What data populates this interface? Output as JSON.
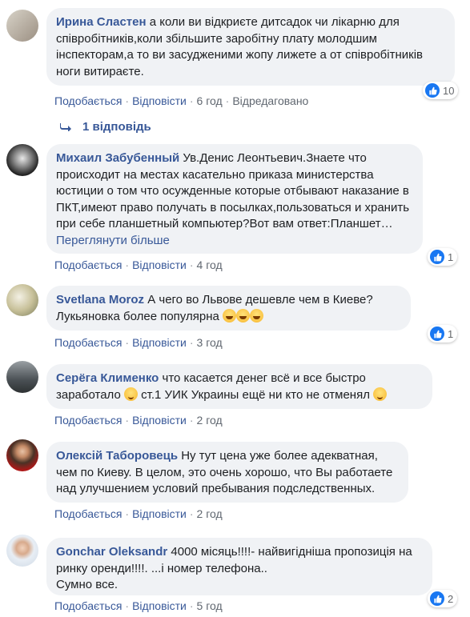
{
  "comments": [
    {
      "author": "Ирина Сластен",
      "text": "а коли ви відкриєте дитсадок чи лікарню для співробітників,коли збільшите заробітну плату молодшим інспекторам,а то ви засудженими жопу лижете а от співробітників ноги витираєте.",
      "like": "Подобається",
      "reply": "Відповісти",
      "time": "6 год",
      "edited": "Відредаговано",
      "reaction_count": "10"
    },
    {
      "author": "Михаил Забубенный",
      "text": "Ув.Денис Леонтьевич.Знаете что происходит на местах касательно приказа министерства юстиции о том что осужденные которые отбывают наказание в ПКТ,имеют право получать в посылках,пользоваться и хранить при себе планшетный компьютер?Вот вам ответ:Планшет…",
      "see_more": "Переглянути більше",
      "like": "Подобається",
      "reply": "Відповісти",
      "time": "4 год",
      "reaction_count": "1"
    },
    {
      "author": "Svetlana Moroz",
      "text": "А чего во Львове дешевле чем в Киеве? Лукьяновка более популярна",
      "like": "Подобається",
      "reply": "Відповісти",
      "time": "3 год",
      "reaction_count": "1"
    },
    {
      "author": "Серёга Клименко",
      "text_a": "что касается денег всё и все быстро заработало",
      "text_b": "ст.1 УИК Украины ещё ни кто не отменял",
      "like": "Подобається",
      "reply": "Відповісти",
      "time": "2 год"
    },
    {
      "author": "Олексій Таборовець",
      "text": "Ну тут цена уже более адекватная, чем по Киеву. В целом, это очень хорошо, что Вы работаете над улучшением условий пребывания подследственных.",
      "like": "Подобається",
      "reply": "Відповісти",
      "time": "2 год"
    },
    {
      "author": "Gonchar Oleksandr",
      "text": "4000 місяць!!!!- найвигідніша пропозиція на ринку оренди!!!!. ...і номер телефона..",
      "text2": "Сумно все.",
      "like": "Подобається",
      "reply": "Відповісти",
      "time": "5 год",
      "reaction_count": "2"
    }
  ],
  "replies_label": "1 відповідь",
  "colors": {
    "link": "#385898",
    "bubble": "#f0f2f5",
    "like_blue": "#1877f2"
  }
}
